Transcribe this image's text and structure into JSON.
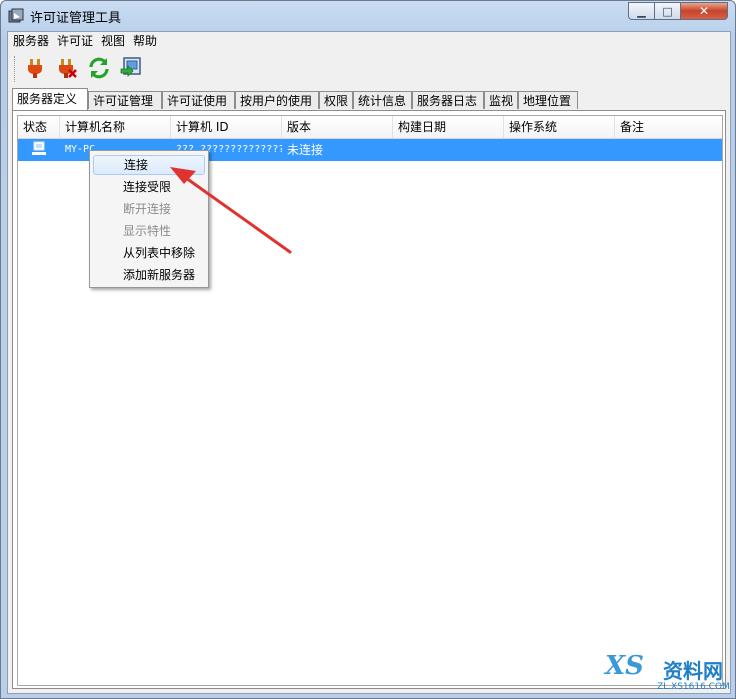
{
  "window": {
    "title": "许可证管理工具",
    "minimize_glyph": "▁",
    "maximize_glyph": "□",
    "close_glyph": "✕"
  },
  "menubar": {
    "items": [
      "服务器",
      "许可证",
      "视图",
      "帮助"
    ]
  },
  "toolbar": {
    "buttons": [
      {
        "icon": "plug-connect-icon"
      },
      {
        "icon": "plug-disconnect-icon"
      },
      {
        "icon": "refresh-icon"
      },
      {
        "icon": "server-properties-icon"
      }
    ]
  },
  "tabs": [
    {
      "label": "服务器定义",
      "active": true
    },
    {
      "label": "许可证管理"
    },
    {
      "label": "许可证使用"
    },
    {
      "label": "按用户的使用"
    },
    {
      "label": "权限"
    },
    {
      "label": "统计信息"
    },
    {
      "label": "服务器日志"
    },
    {
      "label": "监视"
    },
    {
      "label": "地理位置"
    }
  ],
  "table": {
    "columns": [
      "状态",
      "计算机名称",
      "计算机 ID",
      "版本",
      "构建日期",
      "操作系统",
      "备注"
    ],
    "rows": [
      {
        "status_icon": "computer-icon",
        "computer_name": "MY-PC",
        "computer_id": "??? ??????????????",
        "version": "未连接",
        "build_date": "",
        "os": "",
        "note": "",
        "selected": true
      }
    ]
  },
  "context_menu": {
    "items": [
      {
        "label": "连接",
        "enabled": true,
        "hover": true
      },
      {
        "label": "连接受限",
        "enabled": true
      },
      {
        "label": "断开连接",
        "enabled": false
      },
      {
        "label": "显示特性",
        "enabled": false
      },
      {
        "label": "从列表中移除",
        "enabled": true
      },
      {
        "label": "添加新服务器",
        "enabled": true
      }
    ]
  },
  "annotation": {
    "color": "#e0332f"
  },
  "watermark": {
    "logo": "XS",
    "title": "资料网",
    "url": "ZL.XS1616.COM"
  },
  "colors": {
    "selection": "#3399ff",
    "titlebar": "#c9dcf2",
    "close_button": "#c7432a"
  }
}
